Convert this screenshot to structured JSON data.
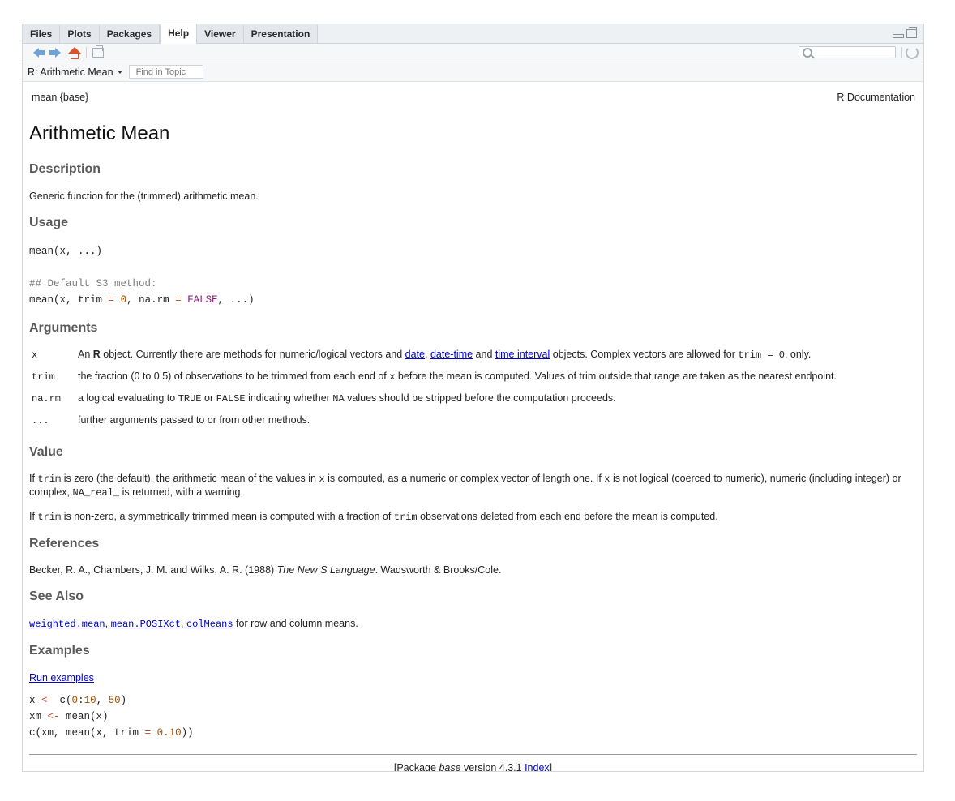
{
  "tabs": [
    {
      "label": "Files",
      "active": false
    },
    {
      "label": "Plots",
      "active": false
    },
    {
      "label": "Packages",
      "active": false
    },
    {
      "label": "Help",
      "active": true
    },
    {
      "label": "Viewer",
      "active": false
    },
    {
      "label": "Presentation",
      "active": false
    }
  ],
  "toolbar": {
    "icons": [
      "back-arrow-icon",
      "forward-arrow-icon",
      "home-icon",
      "popout-icon",
      "search-icon",
      "refresh-icon"
    ],
    "search_value": ""
  },
  "topicbar": {
    "topic": "R: Arithmetic Mean",
    "find_placeholder": "Find in Topic"
  },
  "doc": {
    "header_left": "mean {base}",
    "header_right": "R Documentation",
    "title": "Arithmetic Mean",
    "description_heading": "Description",
    "description_text": "Generic function for the (trimmed) arithmetic mean.",
    "usage_heading": "Usage",
    "usage_line1_fn": "mean(x, ...)",
    "usage_comment": "## Default S3 method:",
    "usage_line2_a": "mean(x, trim ",
    "usage_line2_eq1": "=",
    "usage_line2_zero": "0",
    "usage_line2_b": ", na.rm ",
    "usage_line2_eq2": "=",
    "usage_line2_false": "FALSE",
    "usage_line2_c": ", ...)",
    "arguments_heading": "Arguments",
    "args": {
      "x_name": "x",
      "x_text1": "An ",
      "x_bold": "R",
      "x_text2": " object. Currently there are methods for numeric/logical vectors and ",
      "x_link1": "date",
      "x_comma": ", ",
      "x_link2": "date-time",
      "x_and": " and ",
      "x_link3": "time interval",
      "x_text3": " objects. Complex vectors are allowed for ",
      "x_code": "trim = 0",
      "x_text4": ", only.",
      "trim_name": "trim",
      "trim_text1": "the fraction (0 to 0.5) of observations to be trimmed from each end of ",
      "trim_code": "x",
      "trim_text2": " before the mean is computed. Values of trim outside that range are taken as the nearest endpoint.",
      "narm_name": "na.rm",
      "narm_text1": "a logical evaluating to ",
      "narm_code1": "TRUE",
      "narm_text2": " or ",
      "narm_code2": "FALSE",
      "narm_text3": " indicating whether ",
      "narm_code3": "NA",
      "narm_text4": " values should be stripped before the computation proceeds.",
      "dots_name": "...",
      "dots_text": "further arguments passed to or from other methods."
    },
    "value_heading": "Value",
    "value_p1": {
      "t1": "If ",
      "c1": "trim",
      "t2": " is zero (the default), the arithmetic mean of the values in ",
      "c2": "x",
      "t3": " is computed, as a numeric or complex vector of length one. If ",
      "c3": "x",
      "t4": " is not logical (coerced to numeric), numeric (including integer) or complex, ",
      "c4": "NA_real_",
      "t5": " is returned, with a warning."
    },
    "value_p2": {
      "t1": "If ",
      "c1": "trim",
      "t2": " is non-zero, a symmetrically trimmed mean is computed with a fraction of ",
      "c2": "trim",
      "t3": " observations deleted from each end before the mean is computed."
    },
    "references_heading": "References",
    "ref_text1": "Becker, R. A., Chambers, J. M. and Wilks, A. R. (1988) ",
    "ref_italic": "The New S Language",
    "ref_text2": ". Wadsworth & Brooks/Cole.",
    "seealso_heading": "See Also",
    "seealso_link1": "weighted.mean",
    "seealso_sep1": ", ",
    "seealso_link2": "mean.POSIXct",
    "seealso_sep2": ", ",
    "seealso_link3": "colMeans",
    "seealso_text": " for row and column means.",
    "examples_heading": "Examples",
    "run_examples": "Run examples",
    "ex1_a": "x ",
    "ex1_op": "<-",
    "ex1_b": " c(",
    "ex1_n1": "0",
    "ex1_c": ":",
    "ex1_n2": "10",
    "ex1_d": ", ",
    "ex1_n3": "50",
    "ex1_e": ")",
    "ex2_a": "xm ",
    "ex2_op": "<-",
    "ex2_b": " mean(x)",
    "ex3_a": "c(xm, mean(x, trim ",
    "ex3_eq": "=",
    "ex3_sp": " ",
    "ex3_n": "0.10",
    "ex3_b": "))",
    "footer_t1": "[Package ",
    "footer_italic": "base",
    "footer_t2": " version 4.3.1 ",
    "footer_link": "Index",
    "footer_t3": "]"
  }
}
